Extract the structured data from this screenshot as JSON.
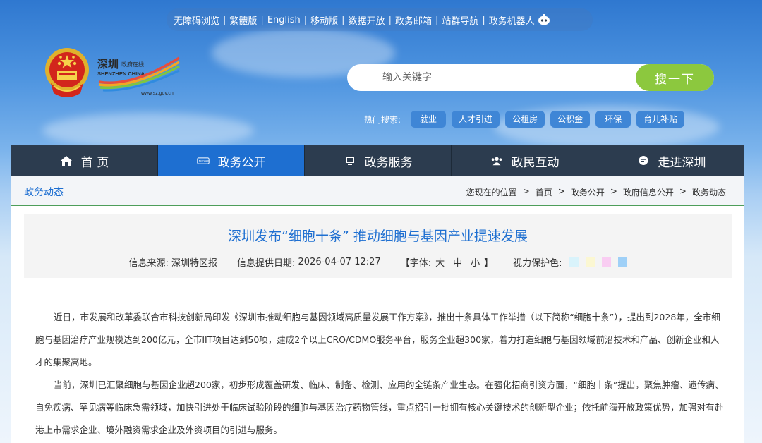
{
  "topbar": {
    "links": [
      "无障碍浏览",
      "繁體版",
      "English",
      "移动版",
      "数据开放",
      "政务邮箱",
      "站群导航",
      "政务机器人"
    ]
  },
  "brand": {
    "name_cn": "深圳",
    "sub_cn": "政府在线",
    "name_en": "SHENZHEN CHINA",
    "url": "www.sz.gov.cn"
  },
  "search": {
    "placeholder": "输入关键字",
    "button": "搜一下"
  },
  "hot": {
    "label": "热门搜索:",
    "tags": [
      "就业",
      "人才引进",
      "公租房",
      "公积金",
      "环保",
      "育儿补贴"
    ]
  },
  "nav": [
    {
      "label": "首 页",
      "icon": "home-icon"
    },
    {
      "label": "政务公开",
      "icon": "news-icon"
    },
    {
      "label": "政务服务",
      "icon": "monitor-icon"
    },
    {
      "label": "政民互动",
      "icon": "people-icon"
    },
    {
      "label": "走进深圳",
      "icon": "chat-icon"
    }
  ],
  "breadcrumb": {
    "section": "政务动态",
    "prefix": "您现在的位置",
    "items": [
      "首页",
      "政务公开",
      "政府信息公开",
      "政务动态"
    ]
  },
  "article": {
    "title": "深圳发布“细胞十条” 推动细胞与基因产业提速发展",
    "source_label": "信息来源:",
    "source": "深圳特区报",
    "date_label": "信息提供日期:",
    "date": "2026-04-07 12:27",
    "font_label": "【字体:",
    "font_sizes": [
      "大",
      "中",
      "小"
    ],
    "font_close": "】",
    "eye_label": "视力保护色:",
    "eye_colors": [
      "#d9f3fb",
      "#fbf7d2",
      "#f9cdf2",
      "#9fd0f7"
    ],
    "paragraphs": [
      "近日，市发展和改革委联合市科技创新局印发《深圳市推动细胞与基因领域高质量发展工作方案》，推出十条具体工作举措（以下简称“细胞十条”），提出到2028年，全市细胞与基因治疗产业规模达到200亿元，全市IIT项目达到50项，建成2个以上CRO/CDMO服务平台，服务企业超300家，着力打造细胞与基因领域前沿技术和产品、创新企业和人才的集聚高地。",
      "当前，深圳已汇聚细胞与基因企业超200家，初步形成覆盖研发、临床、制备、检测、应用的全链条产业生态。在强化招商引资方面，“细胞十条”提出，聚焦肿瘤、遗传病、自免疾病、罕见病等临床急需领域，加快引进处于临床试验阶段的细胞与基因治疗药物管线，重点招引一批拥有核心关键技术的创新型企业；依托前海开放政策优势，加强对有赴港上市需求企业、境外融资需求企业及外资项目的引进与服务。"
    ]
  }
}
